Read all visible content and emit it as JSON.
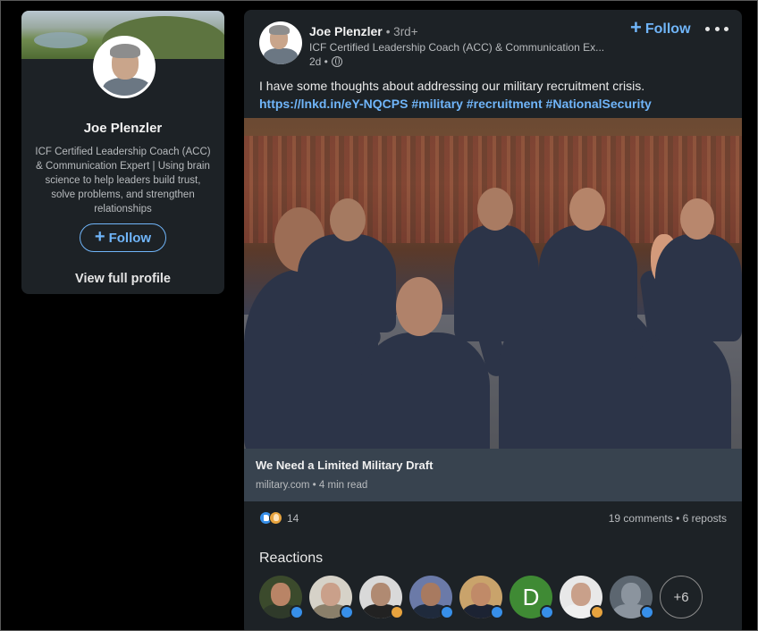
{
  "profile_card": {
    "name": "Joe Plenzler",
    "headline": "ICF Certified Leadership Coach (ACC) & Communication Expert | Using brain science to help leaders build trust, solve problems, and strengthen relationships",
    "follow_label": "Follow",
    "view_profile_label": "View full profile"
  },
  "post": {
    "author_name": "Joe Plenzler",
    "degree": "• 3rd+",
    "author_headline": "ICF Certified Leadership Coach (ACC) & Communication Ex...",
    "age": "2d •",
    "follow_label": "Follow",
    "text": "I have some thoughts about addressing our military recruitment crisis.",
    "link": "https://lnkd.in/eY-NQCPS",
    "hashtags": [
      "#military",
      "#recruitment",
      "#NationalSecurity"
    ],
    "link_card": {
      "title": "We Need a Limited Military Draft",
      "source": "military.com • 4 min read"
    },
    "reaction_count": "14",
    "engagement": "19 comments • 6 reposts",
    "reactions_title": "Reactions",
    "more_reactors_label": "+6",
    "reactors": [
      {
        "kind": "photo",
        "reaction": "like",
        "skin": "#b98466",
        "clothes": "#2f3a2a",
        "bg": "#3b4a2c"
      },
      {
        "kind": "photo",
        "reaction": "like",
        "skin": "#caa08a",
        "clothes": "#8a7f6a",
        "bg": "#d6d2c8"
      },
      {
        "kind": "photo",
        "reaction": "insight",
        "skin": "#b08a72",
        "clothes": "#222222",
        "bg": "#d9d9d9"
      },
      {
        "kind": "photo",
        "reaction": "like",
        "skin": "#a87a60",
        "clothes": "#1f2a3c",
        "bg": "#6b7aa8"
      },
      {
        "kind": "photo",
        "reaction": "like",
        "skin": "#c08a68",
        "clothes": "#1c2333",
        "bg": "#c9a36b"
      },
      {
        "kind": "letter",
        "reaction": "like",
        "letter": "D",
        "bg": "#3f8a34"
      },
      {
        "kind": "photo",
        "reaction": "insight",
        "skin": "#c9a08a",
        "clothes": "#efefef",
        "bg": "#e8e8e8"
      },
      {
        "kind": "photo",
        "reaction": "like",
        "skin": "#8b949e",
        "clothes": "#8b949e",
        "bg": "#5c6670"
      }
    ]
  },
  "colors": {
    "card_bg": "#1d2226",
    "accent_blue": "#70b5f9",
    "link_card_bg": "#38434f"
  }
}
